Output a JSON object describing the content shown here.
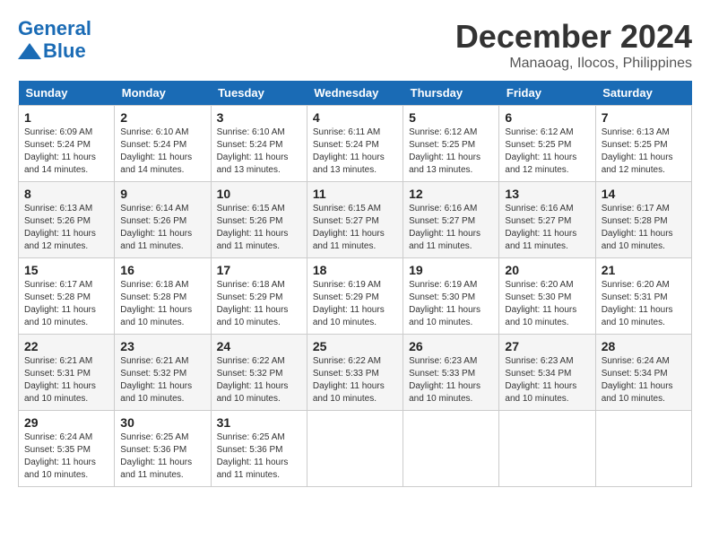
{
  "header": {
    "logo_line1": "General",
    "logo_line2": "Blue",
    "month": "December 2024",
    "location": "Manaoag, Ilocos, Philippines"
  },
  "columns": [
    "Sunday",
    "Monday",
    "Tuesday",
    "Wednesday",
    "Thursday",
    "Friday",
    "Saturday"
  ],
  "weeks": [
    [
      {
        "day": "1",
        "info": "Sunrise: 6:09 AM\nSunset: 5:24 PM\nDaylight: 11 hours\nand 14 minutes."
      },
      {
        "day": "2",
        "info": "Sunrise: 6:10 AM\nSunset: 5:24 PM\nDaylight: 11 hours\nand 14 minutes."
      },
      {
        "day": "3",
        "info": "Sunrise: 6:10 AM\nSunset: 5:24 PM\nDaylight: 11 hours\nand 13 minutes."
      },
      {
        "day": "4",
        "info": "Sunrise: 6:11 AM\nSunset: 5:24 PM\nDaylight: 11 hours\nand 13 minutes."
      },
      {
        "day": "5",
        "info": "Sunrise: 6:12 AM\nSunset: 5:25 PM\nDaylight: 11 hours\nand 13 minutes."
      },
      {
        "day": "6",
        "info": "Sunrise: 6:12 AM\nSunset: 5:25 PM\nDaylight: 11 hours\nand 12 minutes."
      },
      {
        "day": "7",
        "info": "Sunrise: 6:13 AM\nSunset: 5:25 PM\nDaylight: 11 hours\nand 12 minutes."
      }
    ],
    [
      {
        "day": "8",
        "info": "Sunrise: 6:13 AM\nSunset: 5:26 PM\nDaylight: 11 hours\nand 12 minutes."
      },
      {
        "day": "9",
        "info": "Sunrise: 6:14 AM\nSunset: 5:26 PM\nDaylight: 11 hours\nand 11 minutes."
      },
      {
        "day": "10",
        "info": "Sunrise: 6:15 AM\nSunset: 5:26 PM\nDaylight: 11 hours\nand 11 minutes."
      },
      {
        "day": "11",
        "info": "Sunrise: 6:15 AM\nSunset: 5:27 PM\nDaylight: 11 hours\nand 11 minutes."
      },
      {
        "day": "12",
        "info": "Sunrise: 6:16 AM\nSunset: 5:27 PM\nDaylight: 11 hours\nand 11 minutes."
      },
      {
        "day": "13",
        "info": "Sunrise: 6:16 AM\nSunset: 5:27 PM\nDaylight: 11 hours\nand 11 minutes."
      },
      {
        "day": "14",
        "info": "Sunrise: 6:17 AM\nSunset: 5:28 PM\nDaylight: 11 hours\nand 10 minutes."
      }
    ],
    [
      {
        "day": "15",
        "info": "Sunrise: 6:17 AM\nSunset: 5:28 PM\nDaylight: 11 hours\nand 10 minutes."
      },
      {
        "day": "16",
        "info": "Sunrise: 6:18 AM\nSunset: 5:28 PM\nDaylight: 11 hours\nand 10 minutes."
      },
      {
        "day": "17",
        "info": "Sunrise: 6:18 AM\nSunset: 5:29 PM\nDaylight: 11 hours\nand 10 minutes."
      },
      {
        "day": "18",
        "info": "Sunrise: 6:19 AM\nSunset: 5:29 PM\nDaylight: 11 hours\nand 10 minutes."
      },
      {
        "day": "19",
        "info": "Sunrise: 6:19 AM\nSunset: 5:30 PM\nDaylight: 11 hours\nand 10 minutes."
      },
      {
        "day": "20",
        "info": "Sunrise: 6:20 AM\nSunset: 5:30 PM\nDaylight: 11 hours\nand 10 minutes."
      },
      {
        "day": "21",
        "info": "Sunrise: 6:20 AM\nSunset: 5:31 PM\nDaylight: 11 hours\nand 10 minutes."
      }
    ],
    [
      {
        "day": "22",
        "info": "Sunrise: 6:21 AM\nSunset: 5:31 PM\nDaylight: 11 hours\nand 10 minutes."
      },
      {
        "day": "23",
        "info": "Sunrise: 6:21 AM\nSunset: 5:32 PM\nDaylight: 11 hours\nand 10 minutes."
      },
      {
        "day": "24",
        "info": "Sunrise: 6:22 AM\nSunset: 5:32 PM\nDaylight: 11 hours\nand 10 minutes."
      },
      {
        "day": "25",
        "info": "Sunrise: 6:22 AM\nSunset: 5:33 PM\nDaylight: 11 hours\nand 10 minutes."
      },
      {
        "day": "26",
        "info": "Sunrise: 6:23 AM\nSunset: 5:33 PM\nDaylight: 11 hours\nand 10 minutes."
      },
      {
        "day": "27",
        "info": "Sunrise: 6:23 AM\nSunset: 5:34 PM\nDaylight: 11 hours\nand 10 minutes."
      },
      {
        "day": "28",
        "info": "Sunrise: 6:24 AM\nSunset: 5:34 PM\nDaylight: 11 hours\nand 10 minutes."
      }
    ],
    [
      {
        "day": "29",
        "info": "Sunrise: 6:24 AM\nSunset: 5:35 PM\nDaylight: 11 hours\nand 10 minutes."
      },
      {
        "day": "30",
        "info": "Sunrise: 6:25 AM\nSunset: 5:36 PM\nDaylight: 11 hours\nand 11 minutes."
      },
      {
        "day": "31",
        "info": "Sunrise: 6:25 AM\nSunset: 5:36 PM\nDaylight: 11 hours\nand 11 minutes."
      },
      null,
      null,
      null,
      null
    ]
  ]
}
